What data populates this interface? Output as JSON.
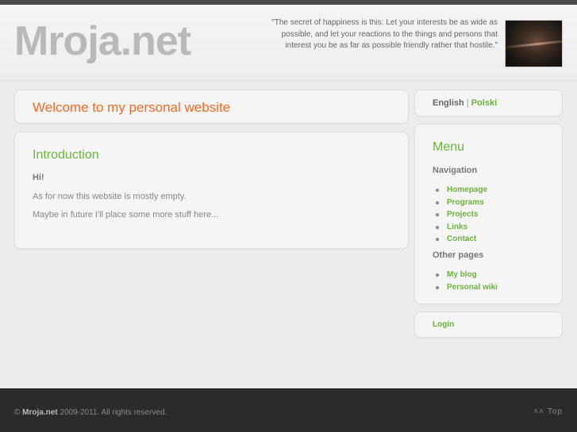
{
  "header": {
    "logo": "Mroja.net",
    "quote": "\"The secret of happiness is this: Let your interests be as wide as possible, and let your reactions to the things and persons that interest you be as far as possible friendly rather that hostile.\""
  },
  "welcome": {
    "title": "Welcome to my personal website"
  },
  "intro": {
    "title": "Introduction",
    "greeting": "Hi!",
    "paragraph1": "As for now this website is mostly empty.",
    "paragraph2": "Maybe in future I'll place some more stuff here..."
  },
  "languages": {
    "english": "English",
    "separator": "|",
    "polski": "Polski"
  },
  "menu": {
    "title": "Menu",
    "navigation_heading": "Navigation",
    "navigation": [
      "Homepage",
      "Programs",
      "Projects",
      "Links",
      "Contact"
    ],
    "other_heading": "Other pages",
    "other": [
      "My blog",
      "Personal wiki"
    ]
  },
  "login": {
    "label": "Login"
  },
  "footer": {
    "copyright_symbol": "©",
    "site": "Mroja.net",
    "text": "2009-2011. All rights reserved.",
    "top_label": "Top"
  },
  "colors": {
    "accent_orange": "#f06d28",
    "accent_green": "#6cb33e",
    "footer_bg": "#2b2b2b"
  }
}
